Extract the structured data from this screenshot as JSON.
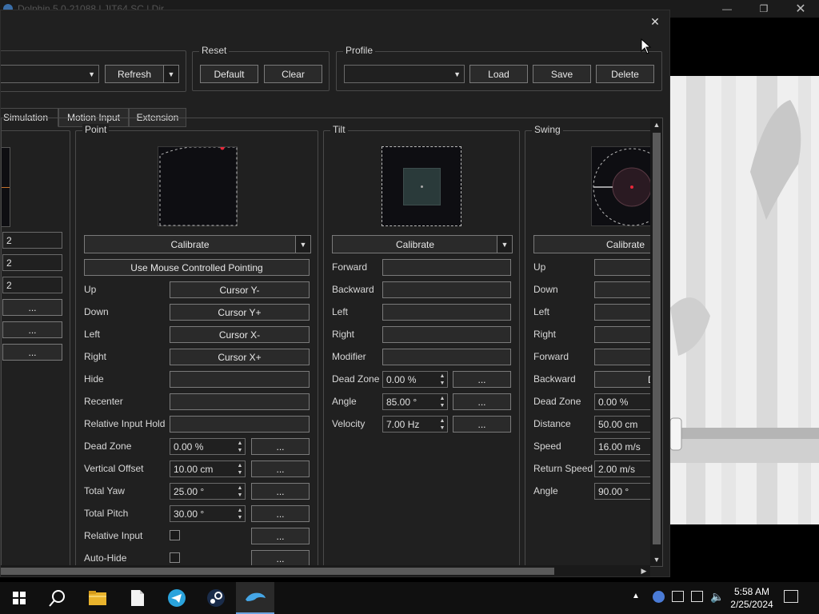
{
  "background_window": {
    "title": "Dolphin 5.0-21088 | JIT64 SC | Dir"
  },
  "dialog": {
    "top": {
      "refresh_label": "Refresh",
      "reset": {
        "title": "Reset",
        "default_label": "Default",
        "clear_label": "Clear"
      },
      "profile": {
        "title": "Profile",
        "value": "",
        "load_label": "Load",
        "save_label": "Save",
        "delete_label": "Delete"
      }
    },
    "tabs": [
      {
        "label": "Simulation",
        "active": true
      },
      {
        "label": "Motion Input",
        "active": false
      },
      {
        "label": "Extension",
        "active": false
      }
    ],
    "left_partial": {
      "fields": [
        "2",
        "2",
        "2"
      ],
      "more_labels": [
        "...",
        "...",
        "..."
      ]
    },
    "point": {
      "title": "Point",
      "calibrate_label": "Calibrate",
      "mouse_label": "Use Mouse Controlled Pointing",
      "mappings": [
        {
          "label": "Up",
          "value": "Cursor Y-"
        },
        {
          "label": "Down",
          "value": "Cursor Y+"
        },
        {
          "label": "Left",
          "value": "Cursor X-"
        },
        {
          "label": "Right",
          "value": "Cursor X+"
        },
        {
          "label": "Hide",
          "value": ""
        },
        {
          "label": "Recenter",
          "value": ""
        },
        {
          "label": "Relative Input Hold",
          "value": ""
        }
      ],
      "settings": [
        {
          "label": "Dead Zone",
          "value": "0.00 %"
        },
        {
          "label": "Vertical Offset",
          "value": "10.00 cm"
        },
        {
          "label": "Total Yaw",
          "value": "25.00 °"
        },
        {
          "label": "Total Pitch",
          "value": "30.00 °"
        }
      ],
      "checks": [
        {
          "label": "Relative Input",
          "checked": false
        },
        {
          "label": "Auto-Hide",
          "checked": false
        }
      ],
      "more_label": "..."
    },
    "tilt": {
      "title": "Tilt",
      "calibrate_label": "Calibrate",
      "mappings": [
        {
          "label": "Forward",
          "value": ""
        },
        {
          "label": "Backward",
          "value": ""
        },
        {
          "label": "Left",
          "value": ""
        },
        {
          "label": "Right",
          "value": ""
        },
        {
          "label": "Modifier",
          "value": ""
        }
      ],
      "settings": [
        {
          "label": "Dead Zone",
          "value": "0.00 %"
        },
        {
          "label": "Angle",
          "value": "85.00 °"
        },
        {
          "label": "Velocity",
          "value": "7.00 Hz"
        }
      ],
      "more_label": "..."
    },
    "swing": {
      "title": "Swing",
      "calibrate_label": "Calibrate",
      "mappings": [
        {
          "label": "Up",
          "value": ""
        },
        {
          "label": "Down",
          "value": ""
        },
        {
          "label": "Left",
          "value": ""
        },
        {
          "label": "Right",
          "value": ""
        },
        {
          "label": "Forward",
          "value": ""
        },
        {
          "label": "Backward",
          "value": "D"
        }
      ],
      "settings": [
        {
          "label": "Dead Zone",
          "value": "0.00 %"
        },
        {
          "label": "Distance",
          "value": "50.00 cm"
        },
        {
          "label": "Speed",
          "value": "16.00 m/s"
        },
        {
          "label": "Return Speed",
          "value": "2.00 m/s"
        },
        {
          "label": "Angle",
          "value": "90.00 °"
        }
      ]
    }
  },
  "taskbar": {
    "time": "5:58 AM",
    "date": "2/25/2024",
    "icons": [
      "windows-start-icon",
      "search-icon",
      "file-explorer-icon",
      "notepad-icon",
      "telegram-icon",
      "steam-icon",
      "dolphin-icon"
    ]
  },
  "colors": {
    "accent_red": "#e8283a",
    "panel_bg": "#202020",
    "border": "#7a7a7a"
  }
}
